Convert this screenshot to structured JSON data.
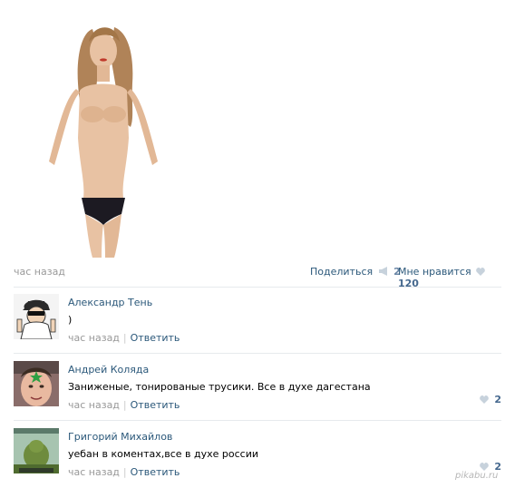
{
  "post": {
    "time": "час назад",
    "share_label": "Поделиться",
    "share_count": "2",
    "like_label": "Мне нравится",
    "like_count": "120"
  },
  "comments": [
    {
      "author": "Александр Тень",
      "text": ")",
      "time": "час назад",
      "reply": "Ответить",
      "likes": ""
    },
    {
      "author": "Андрей Коляда",
      "text": "Заниженые, тонированые трусики. Все в духе дагестана",
      "time": "час назад",
      "reply": "Ответить",
      "likes": "2"
    },
    {
      "author": "Григорий Михайлов",
      "text": "уебан в коментах,все в духе россии",
      "time": "час назад",
      "reply": "Ответить",
      "likes": "2"
    }
  ],
  "watermark": "pikabu.ru",
  "colors": {
    "link": "#2B587A",
    "muted": "#999999",
    "divider": "#e7eaed"
  },
  "icons": {
    "share": "megaphone-icon",
    "like": "heart-icon"
  }
}
